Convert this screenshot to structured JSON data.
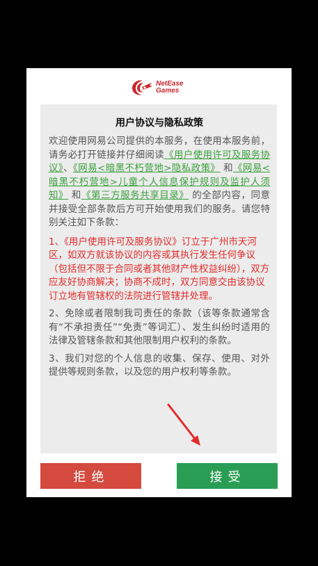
{
  "logo": {
    "line1": "NetEase",
    "line2": "Games"
  },
  "dialog": {
    "title": "用户协议与隐私政策",
    "intro_1": "欢迎使用网易公司提供的本服务，在使用本服务前，请务必打开链接并仔细阅读",
    "link_1": "《用户使用许可及服务协议》",
    "sep_1": "、",
    "link_2": "《网易<暗黑不朽营地>隐私政策》",
    "sep_2": " 和",
    "link_3": "《网易<暗黑不朽营地>儿童个人信息保护规则及监护人须知》",
    "sep_3": " 和",
    "link_4": "《第三方服务共享目录》",
    "intro_2": " 的全部内容，同意并接受全部条款后方可开始使用我们的服务。请您特别关注如下条款：",
    "clause_1": "1、《用户使用许可及服务协议》订立于广州市天河区，如双方就该协议的内容或其执行发生任何争议（包括但不限于合同或者其他财产性权益纠纷），双方应友好协商解决；协商不成时，双方同意交由该协议订立地有管辖权的法院进行管辖并处理。",
    "clause_2": "2、免除或者限制我司责任的条款（该等条款通常含有“不承担责任”“免责”等词汇）、发生纠纷时适用的法律及管辖条款和其他限制用户权利的条款。",
    "clause_3": "3、我们对您的个人信息的收集、保存、使用、对外提供等规则条款，以及您的用户权利等条款。"
  },
  "buttons": {
    "reject": "拒绝",
    "accept": "接受"
  },
  "colors": {
    "reject": "#d44a3e",
    "accept": "#2a9d54",
    "link": "#3aa03c",
    "warning": "#e22b2b",
    "brand": "#c9282d"
  }
}
